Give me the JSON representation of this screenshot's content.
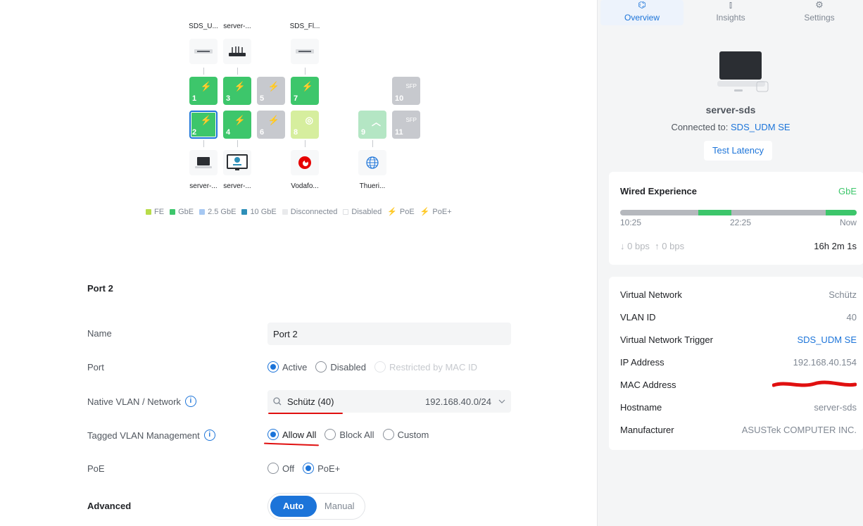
{
  "devices_top": [
    {
      "label": "SDS_U...",
      "icon": "switch-icon"
    },
    {
      "label": "server-...",
      "icon": "router-icon"
    },
    {
      "label": "SDS_Fl...",
      "icon": "switch-icon"
    }
  ],
  "ports_row1": [
    {
      "num": "1",
      "type": "PoE+"
    },
    {
      "num": "3",
      "type": "PoE"
    },
    {
      "num": "5",
      "type": "PoE"
    },
    {
      "num": "7",
      "type": "PoE"
    },
    {
      "num": "10",
      "type": "SFP"
    }
  ],
  "ports_row2": [
    {
      "num": "2",
      "type": "PoE+"
    },
    {
      "num": "4",
      "type": "PoE"
    },
    {
      "num": "6",
      "type": "PoE"
    },
    {
      "num": "8",
      "type": "globe"
    },
    {
      "num": "9",
      "type": "uplink"
    },
    {
      "num": "11",
      "type": "SFP"
    }
  ],
  "sfp_label": "SFP",
  "devices_bottom": [
    {
      "label": "server-...",
      "icon": "laptop-icon"
    },
    {
      "label": "server-...",
      "icon": "monitor-icon"
    },
    {
      "label": "Vodafo...",
      "icon": "vodafone-icon"
    },
    {
      "label": "Thueri...",
      "icon": "globe-icon"
    }
  ],
  "legend": {
    "fe": "FE",
    "gbe": "GbE",
    "g25": "2.5 GbE",
    "g10": "10 GbE",
    "disconnected": "Disconnected",
    "disabled": "Disabled",
    "poe": "PoE",
    "poeplus": "PoE+"
  },
  "colors": {
    "fe": "#b8dc4a",
    "gbe": "#3dc66b",
    "g25": "#a6c8f2",
    "g10": "#2d8fb8",
    "accent": "#1c74d9"
  },
  "form": {
    "section_title": "Port 2",
    "name_label": "Name",
    "name_value": "Port 2",
    "port_label": "Port",
    "port_active": "Active",
    "port_disabled": "Disabled",
    "port_restricted": "Restricted by MAC ID",
    "native_label": "Native VLAN / Network",
    "native_value": "Schütz (40)",
    "native_subnet": "192.168.40.0/24",
    "tagged_label": "Tagged VLAN Management",
    "tagged_allow": "Allow All",
    "tagged_block": "Block All",
    "tagged_custom": "Custom",
    "poe_label": "PoE",
    "poe_off": "Off",
    "poe_plus": "PoE+",
    "advanced_label": "Advanced",
    "adv_auto": "Auto",
    "adv_manual": "Manual"
  },
  "panel": {
    "tabs": [
      {
        "label": "Overview",
        "icon": "binoculars-icon"
      },
      {
        "label": "Insights",
        "icon": "bar-chart-icon"
      },
      {
        "label": "Settings",
        "icon": "gear-icon"
      }
    ],
    "device_name": "server-sds",
    "connected_prefix": "Connected to:",
    "connected_to": "SDS_UDM SE",
    "test_latency": "Test Latency",
    "wired_title": "Wired Experience",
    "wired_value": "GbE",
    "time_start": "10:25",
    "time_mid": "22:25",
    "time_end": "Now",
    "down_rate": "0 bps",
    "up_rate": "0 bps",
    "uptime": "16h 2m 1s",
    "details": [
      {
        "key": "Virtual Network",
        "value": "Schütz",
        "link": false
      },
      {
        "key": "VLAN ID",
        "value": "40",
        "link": false
      },
      {
        "key": "Virtual Network Trigger",
        "value": "SDS_UDM SE",
        "link": true
      },
      {
        "key": "IP Address",
        "value": "192.168.40.154",
        "link": false
      },
      {
        "key": "MAC Address",
        "value": "",
        "link": false
      },
      {
        "key": "Hostname",
        "value": "server-sds",
        "link": false
      },
      {
        "key": "Manufacturer",
        "value": "ASUSTek COMPUTER INC.",
        "link": false
      }
    ]
  }
}
